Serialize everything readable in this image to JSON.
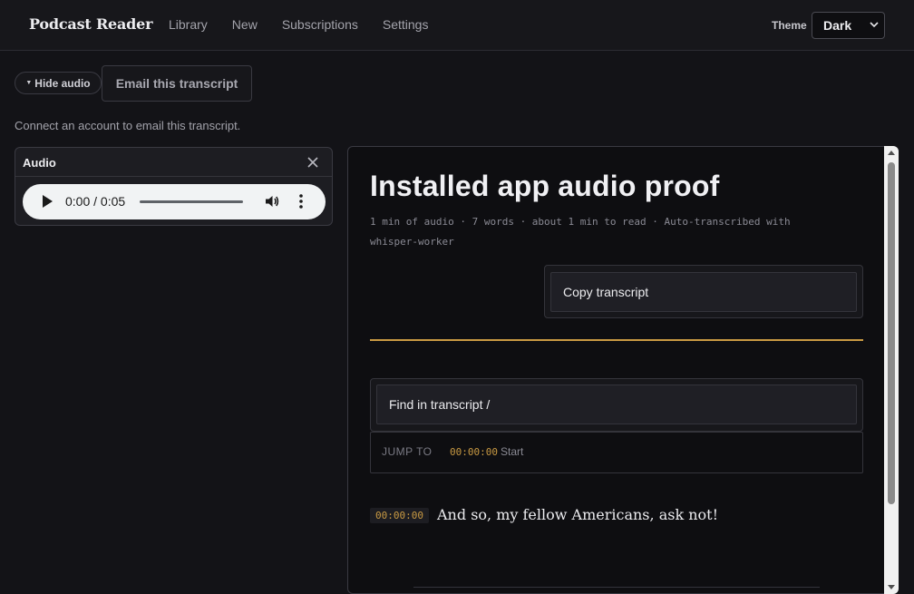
{
  "app": {
    "brand": "Podcast Reader"
  },
  "nav": {
    "items": [
      "Library",
      "New",
      "Subscriptions",
      "Settings"
    ]
  },
  "theme": {
    "label": "Theme",
    "selected": "Dark"
  },
  "toolbar": {
    "hide_audio_label": "Hide audio",
    "email_label": "Email this transcript",
    "connect_message": "Connect an account to email this transcript."
  },
  "audio": {
    "title": "Audio",
    "time": "0:00 / 0:05"
  },
  "episode": {
    "title": "Installed app audio proof",
    "meta": "1 min of audio · 7 words · about 1 min to read · Auto-transcribed with whisper-worker",
    "copy_label": "Copy transcript",
    "find_placeholder": "Find in transcript /",
    "jump_label": "JUMP TO",
    "jump_timestamp": "00:00:00",
    "jump_name": "Start",
    "segments": [
      {
        "timestamp": "00:00:00",
        "text": "And so, my fellow Americans, ask not!"
      }
    ]
  },
  "colors": {
    "accent": "#c99a43",
    "background": "#131317"
  }
}
